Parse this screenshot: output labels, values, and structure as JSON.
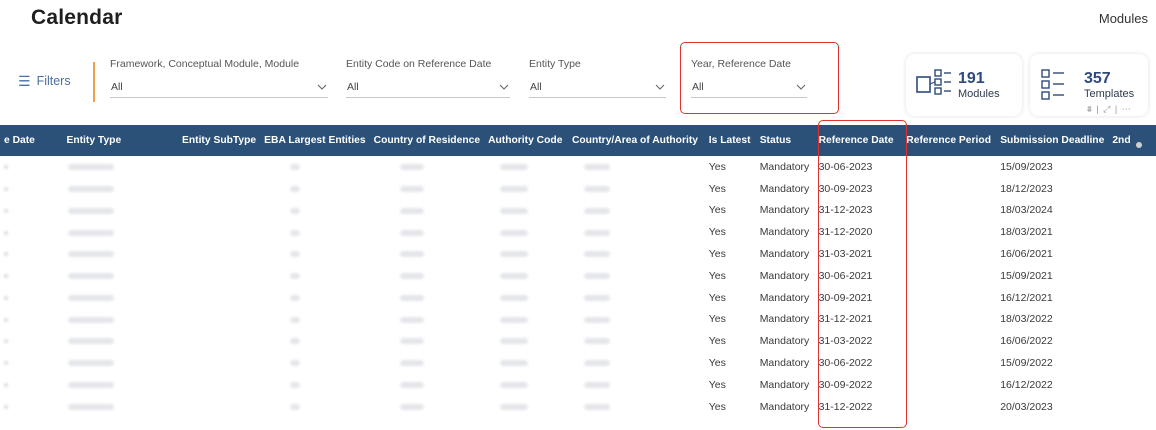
{
  "page": {
    "title": "Calendar",
    "top_link": "Modules"
  },
  "filters": {
    "button_label": "Filters",
    "slicers": [
      {
        "label": "Framework, Conceptual Module, Module",
        "value": "All"
      },
      {
        "label": "Entity Code on Reference Date",
        "value": "All"
      },
      {
        "label": "Entity Type",
        "value": "All"
      },
      {
        "label": "Year, Reference Date",
        "value": "All"
      }
    ]
  },
  "kpis": [
    {
      "value": "191",
      "unit": "Modules",
      "icon": "modules-icon"
    },
    {
      "value": "357",
      "unit": "Templates",
      "icon": "templates-icon"
    }
  ],
  "table": {
    "columns": [
      "e Date",
      "Entity Type",
      "Entity SubType",
      "EBA Largest Entities",
      "Country of Residence",
      "Authority Code",
      "Country/Area of Authority",
      "Is Latest",
      "Status",
      "Reference Date",
      "Reference Period",
      "Submission Deadline",
      "2nd"
    ],
    "rows": [
      {
        "is_latest": "Yes",
        "status": "Mandatory",
        "reference_date": "30-06-2023",
        "submission_deadline": "15/09/2023"
      },
      {
        "is_latest": "Yes",
        "status": "Mandatory",
        "reference_date": "30-09-2023",
        "submission_deadline": "18/12/2023"
      },
      {
        "is_latest": "Yes",
        "status": "Mandatory",
        "reference_date": "31-12-2023",
        "submission_deadline": "18/03/2024"
      },
      {
        "is_latest": "Yes",
        "status": "Mandatory",
        "reference_date": "31-12-2020",
        "submission_deadline": "18/03/2021"
      },
      {
        "is_latest": "Yes",
        "status": "Mandatory",
        "reference_date": "31-03-2021",
        "submission_deadline": "16/06/2021"
      },
      {
        "is_latest": "Yes",
        "status": "Mandatory",
        "reference_date": "30-06-2021",
        "submission_deadline": "15/09/2021"
      },
      {
        "is_latest": "Yes",
        "status": "Mandatory",
        "reference_date": "30-09-2021",
        "submission_deadline": "16/12/2021"
      },
      {
        "is_latest": "Yes",
        "status": "Mandatory",
        "reference_date": "31-12-2021",
        "submission_deadline": "18/03/2022"
      },
      {
        "is_latest": "Yes",
        "status": "Mandatory",
        "reference_date": "31-03-2022",
        "submission_deadline": "16/06/2022"
      },
      {
        "is_latest": "Yes",
        "status": "Mandatory",
        "reference_date": "30-06-2022",
        "submission_deadline": "15/09/2022"
      },
      {
        "is_latest": "Yes",
        "status": "Mandatory",
        "reference_date": "30-09-2022",
        "submission_deadline": "16/12/2022"
      },
      {
        "is_latest": "Yes",
        "status": "Mandatory",
        "reference_date": "31-12-2022",
        "submission_deadline": "20/03/2023"
      }
    ]
  },
  "colors": {
    "header_bg": "#2c5178",
    "highlight": "#e0322f",
    "filter_divider": "#f0a04b",
    "kpi_text": "#2e4a7d"
  }
}
